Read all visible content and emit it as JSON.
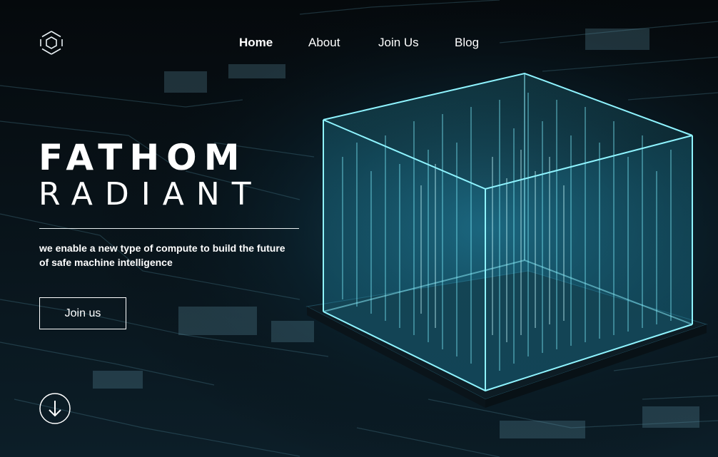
{
  "nav": {
    "items": [
      {
        "label": "Home",
        "active": true
      },
      {
        "label": "About",
        "active": false
      },
      {
        "label": "Join Us",
        "active": false
      },
      {
        "label": "Blog",
        "active": false
      }
    ]
  },
  "logo": {
    "icon": "hexagon-logo-icon"
  },
  "hero": {
    "brand_line1": "FATHOM",
    "brand_line2": "RADIANT",
    "tagline": "we enable a new type of compute to build the future of safe machine intelligence",
    "cta_label": "Join us",
    "scroll_icon": "arrow-down-circle-icon"
  },
  "colors": {
    "background": "#05090c",
    "accent": "#3ad6f0",
    "text": "#ffffff"
  }
}
